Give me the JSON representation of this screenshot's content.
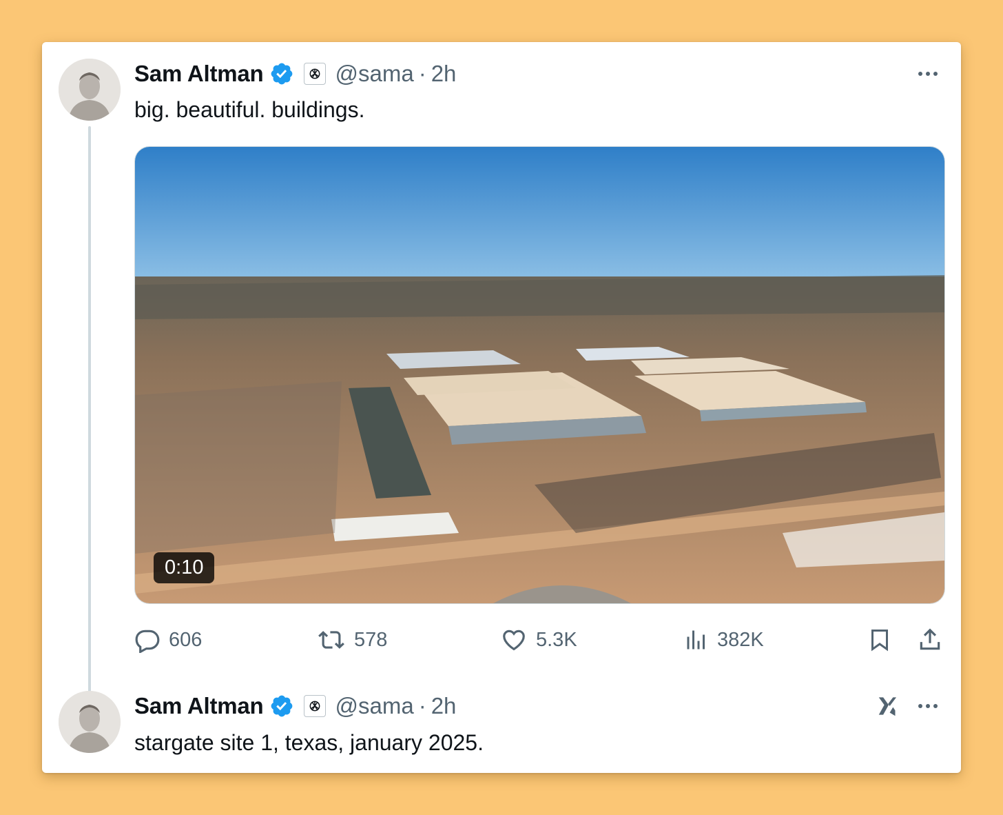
{
  "tweets": [
    {
      "author": {
        "name": "Sam Altman",
        "handle": "@sama",
        "verified": true,
        "org_badge_icon": "openai-logo-icon"
      },
      "separator": "·",
      "time": "2h",
      "text": "big. beautiful. buildings.",
      "media": {
        "type": "video",
        "duration": "0:10"
      },
      "actions": {
        "replies": "606",
        "reposts": "578",
        "likes": "5.3K",
        "views": "382K"
      }
    },
    {
      "author": {
        "name": "Sam Altman",
        "handle": "@sama",
        "verified": true,
        "org_badge_icon": "openai-logo-icon"
      },
      "separator": "·",
      "time": "2h",
      "text": "stargate site 1, texas, january 2025."
    }
  ],
  "colors": {
    "background": "#FBC675",
    "card": "#FFFFFF",
    "verified": "#1D9BF0",
    "text": "#0F1419",
    "secondary": "#536471"
  }
}
